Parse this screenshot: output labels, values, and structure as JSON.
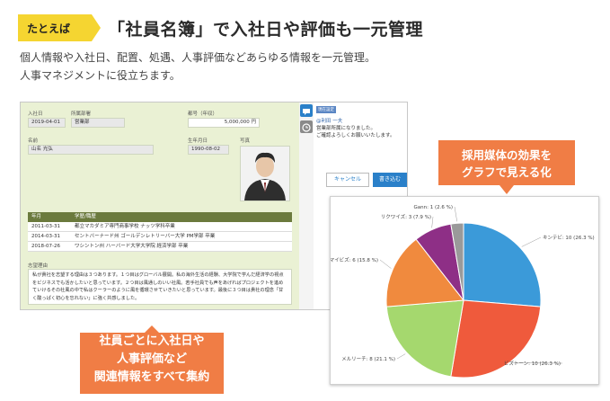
{
  "header": {
    "tag": "たとえば",
    "headline": "「社員名簿」で入社日や評価も一元管理",
    "desc_line1": "個人情報や入社日、配置、処遇、人事評価などあらゆる情報を一元管理。",
    "desc_line2": "人事マネジメントに役立ちます。"
  },
  "colors": {
    "accent_yellow": "#f5d531",
    "callout_orange": "#f07d45",
    "form_bg": "#eaf1d4",
    "table_header": "#6b7a3d",
    "button_blue": "#2a80c9"
  },
  "form": {
    "join_date_label": "入社日",
    "join_date": "2019-04-01",
    "dept_label": "所属部署",
    "dept": "営業部",
    "salary_label": "都号（年収）",
    "salary": "5,000,000 円",
    "name_label": "名前",
    "name": "山名 光弘",
    "birth_label": "生年月日",
    "birth": "1990-08-02",
    "photo_label": "写真",
    "history_headers": [
      "年月",
      "学歴/職歴"
    ],
    "history": [
      {
        "date": "2011-03-31",
        "text": "都立マカダミア専門商事学校 ナッツ学科卒業"
      },
      {
        "date": "2014-03-31",
        "text": "セントバーナード州 ゴールデンレトリーバー大学 PM学部 卒業"
      },
      {
        "date": "2018-07-26",
        "text": "ワシントン州 ハーバード大学大学院 経済学部 卒業"
      }
    ],
    "motive_label": "志望理由",
    "motive": "私が貴社を志望する理由は３つあります。１つ目はグローバル展開。私の海外生活の経験、大学院で学んだ経済学の視点をビジネスでも活かしたいと思っています。２つ目は風通しのいい社風。若手社員でも声をあげればプロジェクトを進めていけるその社風の中で私はクーラーのように風を循環させていきたいと思っています。最後に３つ目は貴社の理念「甘く酸っぱく初心を忘れない」に強く共感しました。"
  },
  "chat": {
    "header": "現在設定",
    "name": "@利田 一夫",
    "message_line1": "営業部所属になりました。",
    "message_line2": "ご確認よろしくお願いいたします。",
    "cancel": "キャンセル",
    "submit": "書き込む"
  },
  "callouts": {
    "left_line1": "社員ごとに入社日や",
    "left_line2": "人事評価など",
    "left_line3": "関連情報をすべて集約",
    "right_line1": "採用媒体の効果を",
    "right_line2": "グラフで見える化"
  },
  "chart_data": {
    "type": "pie",
    "labels": [
      "キンテビ: 10 (26.3 %)",
      "ビズトーン: 10 (26.3 %)",
      "メルリーチ: 8 (21.1 %)",
      "マイビズ: 6 (15.8 %)",
      "リクワイズ: 3 (7.9 %)",
      "Gann: 1 (2.6 %)"
    ],
    "values": [
      10,
      10,
      8,
      6,
      3,
      1
    ],
    "colors": [
      "#3b9ad9",
      "#ef5a3c",
      "#a5d86e",
      "#f08a3e",
      "#8e2f86",
      "#9a9a9a"
    ]
  }
}
